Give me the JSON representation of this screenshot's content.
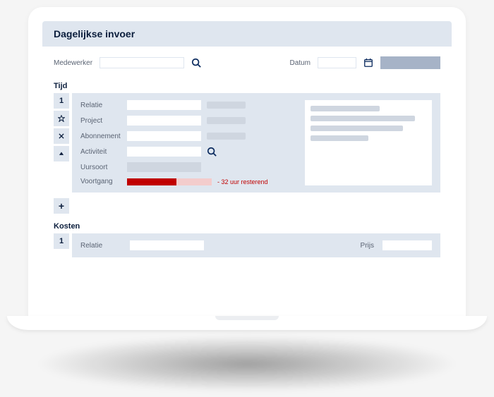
{
  "header": {
    "title": "Dagelijkse invoer"
  },
  "filters": {
    "employee_label": "Medewerker",
    "date_label": "Datum"
  },
  "tijd": {
    "title": "Tijd",
    "row_number": "1",
    "fields": {
      "relatie": "Relatie",
      "project": "Project",
      "abonnement": "Abonnement",
      "activiteit": "Activiteit",
      "uursoort": "Uursoort",
      "voortgang": "Voortgang"
    },
    "progress_text": "- 32 uur resterend",
    "add_label": "+"
  },
  "kosten": {
    "title": "Kosten",
    "row_number": "1",
    "relatie_label": "Relatie",
    "prijs_label": "Prijs"
  }
}
